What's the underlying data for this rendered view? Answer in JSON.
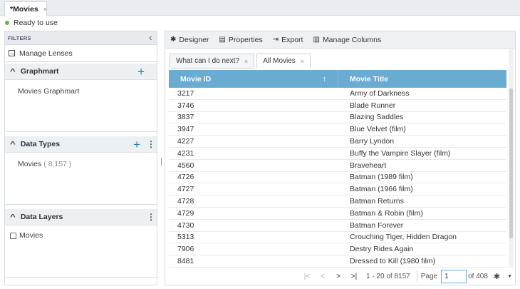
{
  "doc_tab": {
    "label": "*Movies",
    "close": "×"
  },
  "status": {
    "text": "Ready to use",
    "color": "#6cb33f"
  },
  "left": {
    "filters_label": "FILTERS",
    "collapse_glyph": "‹",
    "manage_lenses": "Manage Lenses",
    "sections": [
      {
        "title": "Graphmart",
        "body": "Movies Graphmart"
      },
      {
        "title": "Data Types",
        "body": "Movies",
        "count": "( 8,157 )"
      },
      {
        "title": "Data Layers",
        "body": "Movies"
      }
    ]
  },
  "toolbar": {
    "designer": "Designer",
    "properties": "Properties",
    "export": "Export",
    "manage_columns": "Manage Columns"
  },
  "view_tabs": [
    {
      "label": "What can I do next?",
      "close": "×"
    },
    {
      "label": "All Movies",
      "close": "×"
    }
  ],
  "grid": {
    "columns": [
      "Movie ID",
      "Movie Title"
    ],
    "sort_glyph": "↑",
    "header_color": "#6aabd2",
    "rows": [
      [
        "3217",
        "Army of Darkness"
      ],
      [
        "3746",
        "Blade Runner"
      ],
      [
        "3837",
        "Blazing Saddles"
      ],
      [
        "3947",
        "Blue Velvet (film)"
      ],
      [
        "4227",
        "Barry Lyndon"
      ],
      [
        "4231",
        "Buffy the Vampire Slayer (film)"
      ],
      [
        "4560",
        "Braveheart"
      ],
      [
        "4726",
        "Batman (1989 film)"
      ],
      [
        "4727",
        "Batman (1966 film)"
      ],
      [
        "4728",
        "Batman Returns"
      ],
      [
        "4729",
        "Batman & Robin (film)"
      ],
      [
        "4730",
        "Batman Forever"
      ],
      [
        "5313",
        "Crouching Tiger, Hidden Dragon"
      ],
      [
        "7906",
        "Destry Rides Again"
      ],
      [
        "8481",
        "Dressed to Kill (1980 film)"
      ]
    ]
  },
  "pager": {
    "first": "|<",
    "prev": "<",
    "next": ">",
    "last": ">|",
    "range": "1 - 20 of 8157",
    "page_label": "Page",
    "page_value": "1",
    "of_pages": "of 408"
  }
}
